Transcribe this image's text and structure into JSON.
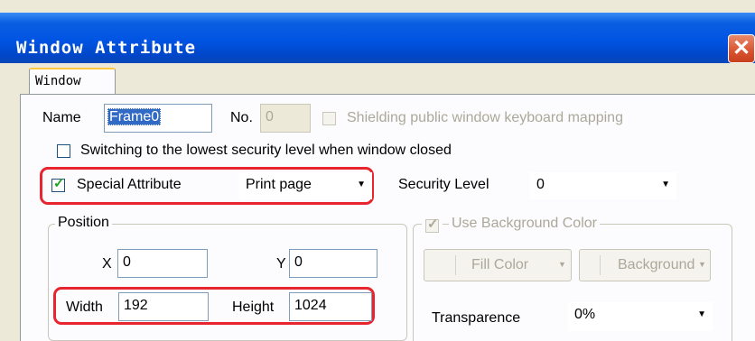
{
  "window": {
    "title": "Window Attribute",
    "close_label": "✕"
  },
  "tabs": [
    {
      "label": "Window",
      "active": true
    }
  ],
  "form": {
    "name_label": "Name",
    "name_value": "Frame0",
    "no_label": "No.",
    "no_value": "0",
    "shielding_label": "Shielding public window keyboard mapping",
    "shielding_checked": false,
    "switching_label": "Switching to the lowest security level when window closed",
    "switching_checked": false,
    "special_label": "Special Attribute",
    "special_checked": true,
    "special_value": "Print page",
    "security_label": "Security Level",
    "security_value": "0"
  },
  "position": {
    "group_label": "Position",
    "x_label": "X",
    "x_value": "0",
    "y_label": "Y",
    "y_value": "0",
    "width_label": "Width",
    "width_value": "192",
    "height_label": "Height",
    "height_value": "1024"
  },
  "background": {
    "use_bg_label": "Use Background Color",
    "use_bg_checked": true,
    "fill_color_label": "Fill Color",
    "background_label": "Background",
    "transparence_label": "Transparence",
    "transparence_value": "0%"
  },
  "icons": {
    "check": "✓",
    "dropdown": "▼"
  },
  "colors": {
    "titlebar": "#0054e3",
    "dialog_bg": "#ece9d8",
    "panel_bg": "#fcfcfe",
    "highlight_outline": "#e8242e",
    "selection": "#316ac5"
  }
}
